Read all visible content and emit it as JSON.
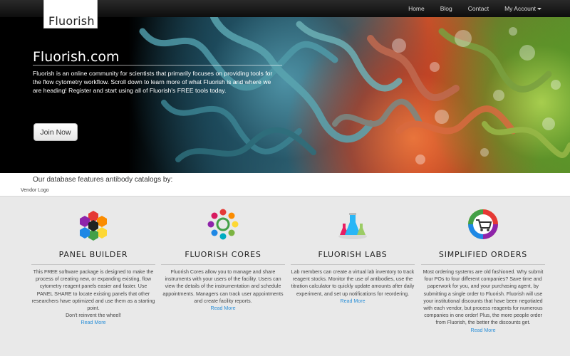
{
  "brand": {
    "logo_text": "Fluorish"
  },
  "nav": {
    "items": [
      {
        "label": "Home"
      },
      {
        "label": "Blog"
      },
      {
        "label": "Contact"
      },
      {
        "label": "My Account"
      }
    ]
  },
  "hero": {
    "title": "Fluorish.com",
    "text": "Fluorish is an online community for scientists that primarily focuses on providing tools for the flow cytometry workflow. Scroll down to learn more of what Fluorish is and where we are heading! Register and start using all of Fluorish's FREE tools today.",
    "join_label": "Join Now",
    "prev_label": "‹",
    "next_label": "›"
  },
  "vendors": {
    "heading": "Our database features antibody catalogs by:",
    "logo_alt": "Vendor Logo"
  },
  "features": [
    {
      "title": "PANEL BUILDER",
      "icon": "panel-builder-icon",
      "desc": "This FREE software package is designed to make the process of creating new, or expanding existing, flow cytometry reagent panels easier and faster. Use PANEL SHARE to locate existing panels that other researchers have optimized and use them as a starting point.",
      "desc2": "Don't reinvent the wheel!",
      "link": "Read More"
    },
    {
      "title": "FLUORISH CORES",
      "icon": "cores-icon",
      "desc": "Fluorish Cores allow you to manage and share instruments with your users of the facility. Users can view the details of the instrumentation and schedule appointments. Managers can track user appointments and create facility reports.",
      "desc2": "",
      "link": "Read More"
    },
    {
      "title": "FLUORISH LABS",
      "icon": "labs-flask-icon",
      "desc": "Lab members can create a virtual lab inventory to track reagent stocks. Monitor the use of antibodies, use the titration calculator to quickly update amounts after daily experiment, and set up notifications for reordering.",
      "desc2": "",
      "link": "Read More"
    },
    {
      "title": "SIMPLIFIED ORDERS",
      "icon": "shopping-cart-icon",
      "desc": "Most ordering systems are old fashioned. Why submit four POs to four different companies? Save time and paperwork for you, and your purchasing agent, by submitting a single order to Fluorish. Fluorish will use your institutional discounts that have been negotiated with each vendor, but process reagents for numerous companies in one order! Plus, the more people order from Fluorish, the better the discounts get.",
      "desc2": "",
      "link": "Read More"
    }
  ]
}
